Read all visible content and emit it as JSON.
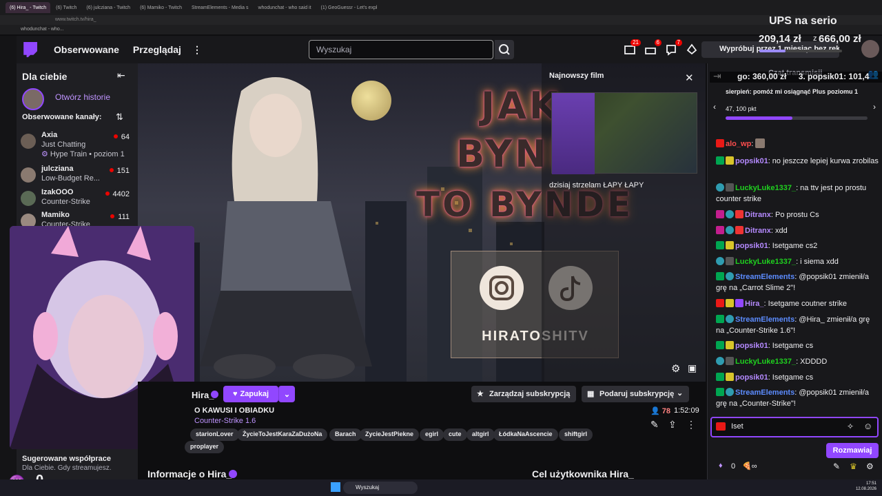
{
  "browser": {
    "tabs": [
      "(6) Hira_ - Twitch",
      "(6) Twitch",
      "(6) julcziana - Twitch",
      "(6) Mamiko - Twitch",
      "StreamElements - Media s",
      "whodunchat - who said it",
      "(1) GeoGuessr - Let's expl"
    ],
    "url": "www.twitch.tv/hira_",
    "bookmark": "whodunchat - who..."
  },
  "nav": {
    "followed": "Obserwowane",
    "browse": "Przeglądaj",
    "search_placeholder": "Wyszukaj",
    "badge1": "21",
    "badge2": "6",
    "badge3": "7",
    "trial": "Wypróbuj przez 1 miesiąc bez reklam"
  },
  "sidebar": {
    "title": "Dla ciebie",
    "stories": "Otwórz historie",
    "followed_label": "Obserwowane kanały:",
    "channels": [
      {
        "name": "Axia",
        "game": "Just Chatting",
        "viewers": "64",
        "extra": "Hype Train • poziom 1"
      },
      {
        "name": "julcziana",
        "game": "Low-Budget Re...",
        "viewers": "151"
      },
      {
        "name": "IzakOOO",
        "game": "Counter-Strike",
        "viewers": "4402"
      },
      {
        "name": "Mamiko",
        "game": "Counter-Strike",
        "viewers": "111"
      }
    ],
    "suggested_title": "Sugerowane współprace",
    "suggested_sub": "Dla Ciebie. Gdy streamujesz."
  },
  "player": {
    "banner_line1": "JAK",
    "banner_line2": "BYNDE",
    "banner_line3": "TO BYNDE",
    "socials_text": "HIRATOSHITV",
    "latest_title": "Najnowszy film",
    "latest_caption": "dzisiaj strzelam ŁAPY ŁAPY"
  },
  "stream": {
    "name": "Hira_",
    "follow_button": "Zapukaj",
    "manage_sub": "Zarządzaj subskrypcją",
    "gift_sub": "Podaruj subskrypcję",
    "title": "O KAWUSI I OBIADKU",
    "game": "Counter-Strike 1.6",
    "viewers": "78",
    "uptime": "1:52:09",
    "tags": [
      "starionLover",
      "ŻycieToJestKaraZaDużoNa",
      "Barach",
      "ZycieJestPiekne",
      "egirl",
      "cute",
      "altgirl",
      "ŁódkaNaAscencie",
      "shiftgirl",
      "proplayer"
    ],
    "about": "Informacje o Hira_",
    "goal": "Cel użytkownika Hira_"
  },
  "overlay": {
    "ups": "UPS na serio",
    "amount": "209,14 zł",
    "of": "z",
    "goal": "666,00 zł",
    "ticker1": "go: 360,00 zł",
    "ticker2": "3. popsik01: 101,4"
  },
  "chat": {
    "header": "Czat transmisji",
    "goal_text": "sierpień: pomóż mi osiągnąć Plus poziomu 1",
    "goal_progress": "47, 100 pkt",
    "goal_fraction": 0.47,
    "messages": [
      {
        "user": "alo_wp",
        "text": ":",
        "color": "#ff4d4d"
      },
      {
        "user": "popsik01",
        "text": ": no jeszcze lepiej kurwa zrobilas",
        "color": "#b58aff"
      },
      {
        "user": "LuckyLuke1337_",
        "text": ": na ttv jest po prostu counter strike",
        "color": "#1fd11f"
      },
      {
        "user": "Ditranx",
        "text": ": Po prostu Cs",
        "color": "#b58aff"
      },
      {
        "user": "Ditranx",
        "text": ": xdd",
        "color": "#b58aff"
      },
      {
        "user": "popsik01",
        "text": ": Isetgame cs2",
        "color": "#b58aff"
      },
      {
        "user": "LuckyLuke1337_",
        "text": ": i siema xdd",
        "color": "#1fd11f"
      },
      {
        "user": "StreamElements",
        "text": ": @popsik01 zmienił/a grę na „Carrot Slime 2\"!",
        "color": "#5c8cff"
      },
      {
        "user": "Hira_",
        "text": ": Isetgame coutner strike",
        "color": "#b58aff"
      },
      {
        "user": "StreamElements",
        "text": ": @Hira_ zmienił/a grę na „Counter-Strike 1.6\"!",
        "color": "#5c8cff"
      },
      {
        "user": "popsik01",
        "text": ": Isetgame cs",
        "color": "#b58aff"
      },
      {
        "user": "LuckyLuke1337_",
        "text": ": XDDDD",
        "color": "#1fd11f"
      },
      {
        "user": "popsik01",
        "text": ": Isetgame cs",
        "color": "#b58aff"
      },
      {
        "user": "StreamElements",
        "text": ": @popsik01 zmienił/a grę na „Counter-Strike\"!",
        "color": "#5c8cff"
      }
    ],
    "input_value": "Iset",
    "send": "Rozmawiaj",
    "points": "0"
  },
  "taskbar": {
    "search": "Wyszukaj",
    "time": "17:51",
    "date": "12.08.2026"
  },
  "bottom_counter": "0"
}
